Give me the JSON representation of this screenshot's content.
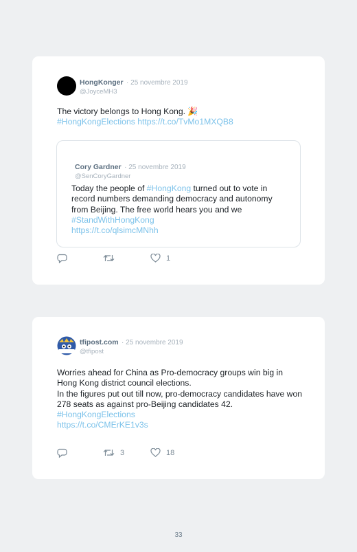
{
  "tweets": [
    {
      "author": "HongKonger",
      "date": "· 25 novembre 2019",
      "handle": "@JoyceMH3",
      "text": "The victory belongs to Hong Kong. 🎉",
      "hashtag": "#HongKongElections",
      "link": "https://t.co/TvMo1MXQB8",
      "quoted": {
        "author": "Cory Gardner",
        "date": "· 25 novembre 2019",
        "handle": "@SenCoryGardner",
        "text_a": "Today the people of ",
        "hashtag_a": "#HongKong",
        "text_b": " turned out to vote in record numbers demanding democracy and autonomy from Beijing. The free world hears you and we ",
        "hashtag_b": "#StandWithHongKong",
        "link": "https://t.co/qlsimcMNhh"
      },
      "retweets": "",
      "likes": "1"
    },
    {
      "author": "tfipost.com",
      "date": "· 25 novembre 2019",
      "handle": "@tfipost",
      "avatar_text": "tfipost",
      "text_line1": "Worries ahead for China as Pro-democracy groups win big in Hong Kong district council elections.",
      "text_line2": "In the figures put out till now, pro-democracy candidates have won 278 seats as against pro-Beijing candidates 42.",
      "hashtag": "#HongKongElections",
      "link": "https://t.co/CMErKE1v3s",
      "retweets": "3",
      "likes": "18"
    }
  ],
  "page_number": "33",
  "icons": {
    "reply": "reply-icon",
    "retweet": "retweet-icon",
    "like": "heart-icon"
  },
  "colors": {
    "background": "#eef0f2",
    "card": "#ffffff",
    "link": "#7cc2ea",
    "name": "#5c6f80",
    "meta": "#a7b2bc",
    "icon": "#7b8a96"
  }
}
